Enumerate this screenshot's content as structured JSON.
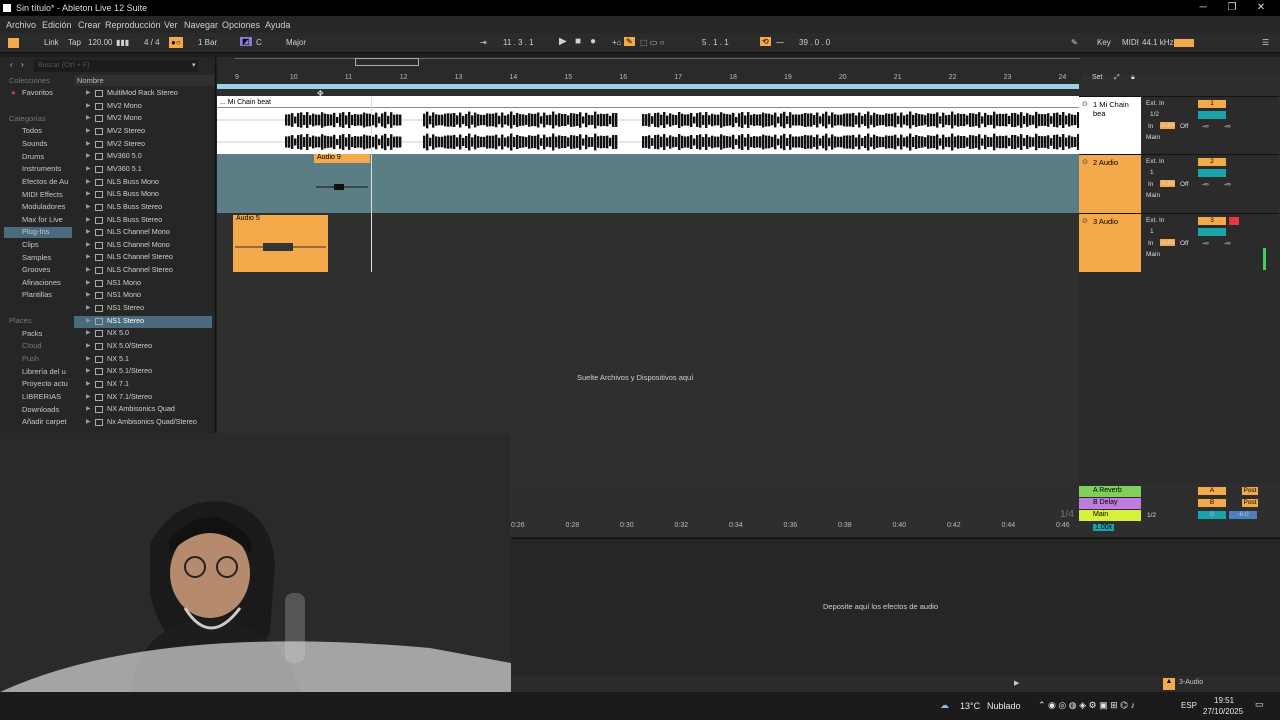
{
  "window": {
    "title": "Sin título* - Ableton Live 12 Suite"
  },
  "menu": [
    "Archivo",
    "Edición",
    "Crear",
    "Reproducción",
    "Ver",
    "Navegar",
    "Opciones",
    "Ayuda"
  ],
  "controlbar": {
    "link": "Link",
    "tap": "Tap",
    "tempo": "120.00",
    "signature": "4 / 4",
    "quantize": "1 Bar",
    "key": "C",
    "scale": "Major",
    "position": "11 .  3 .  1",
    "punch": "5 .  1 .  1",
    "loop_len": "39 .  0 .  0",
    "key_label": "Key",
    "midi_label": "MIDI",
    "sample_rate": "44.1 kHz"
  },
  "browser": {
    "search_placeholder": "Buscar (Ctrl + F)",
    "colecciones_header": "Colecciones",
    "favoritos": "Favoritos",
    "categorias_header": "Categorías",
    "categories": [
      "Todos",
      "Sounds",
      "Drums",
      "Instruments",
      "Efectos de Au",
      "MIDI Effects",
      "Moduladores",
      "Max for Live",
      "Plug-Ins",
      "Clips",
      "Samples",
      "Grooves",
      "Afinaciones",
      "Plantillas"
    ],
    "selected_category": "Plug-Ins",
    "places_header": "Places",
    "places": [
      "Packs",
      "Cloud",
      "Push",
      "Librería del u",
      "Proyecto actu",
      "LIBRERIAS",
      "Downloads",
      "Añadir carpet"
    ],
    "column_header": "Nombre",
    "items": [
      "MultiMod Rack Stereo",
      "MV2 Mono",
      "MV2 Mono",
      "MV2 Stereo",
      "MV2 Stereo",
      "MV360 5.0",
      "MV360 5.1",
      "NLS Buss Mono",
      "NLS Buss Mono",
      "NLS Buss Stereo",
      "NLS Buss Stereo",
      "NLS Channel Mono",
      "NLS Channel Mono",
      "NLS Channel Stereo",
      "NLS Channel Stereo",
      "NS1 Mono",
      "NS1 Mono",
      "NS1 Stereo",
      "NS1 Stereo",
      "NX 5.0",
      "NX 5.0/Stereo",
      "NX 5.1",
      "NX 5.1/Stereo",
      "NX 7.1",
      "NX 7.1/Stereo",
      "NX Ambisonics Quad",
      "Nx Ambisonics Quad/Stereo"
    ],
    "selected_item": "NS1 Stereo"
  },
  "arrangement": {
    "ruler": [
      "9",
      "10",
      "11",
      "12",
      "13",
      "14",
      "15",
      "16",
      "17",
      "18",
      "19",
      "20",
      "21",
      "22",
      "23",
      "24"
    ],
    "set_label": "Set",
    "clips": {
      "t1": "Mi Chain beat",
      "t2": "Audio 9",
      "t3": "Audio 5"
    },
    "drop_hint": "Suelte Archivos y Dispositivos aquí",
    "tracks": [
      {
        "name": "1 Mi Chain bea",
        "input": "Ext. In",
        "channel": "1/2",
        "out": "Main",
        "num": "1",
        "color": "#ffffff"
      },
      {
        "name": "2 Audio",
        "input": "Ext. In",
        "channel": "1",
        "out": "Main",
        "num": "2",
        "color": "#f4a94a"
      },
      {
        "name": "3 Audio",
        "input": "Ext. In",
        "channel": "1",
        "out": "Main",
        "num": "3",
        "color": "#f4a94a"
      }
    ],
    "monitor": {
      "in": "In",
      "auto": "Auto",
      "off": "Off",
      "inf": "-∞"
    },
    "returns": [
      {
        "name": "A Reverb",
        "letter": "A",
        "post": "Post",
        "color": "#7ed05a"
      },
      {
        "name": "B Delay",
        "letter": "B",
        "post": "Post",
        "color": "#c07be0"
      },
      {
        "name": "Main",
        "channel": "1/2",
        "vol": "0",
        "pan": "-6.0",
        "color": "#d6f03c"
      }
    ],
    "zoom": "1/4",
    "speed": "1.00x",
    "times": [
      "0:26",
      "0:28",
      "0:30",
      "0:32",
      "0:34",
      "0:36",
      "0:38",
      "0:40",
      "0:42",
      "0:44",
      "0:46"
    ]
  },
  "device_view": {
    "hint": "Deposite aquí los efectos de audio",
    "track_label": "3-Audio"
  },
  "taskbar": {
    "temp": "13°C",
    "weather": "Nublado",
    "lang": "ESP",
    "time": "19:51",
    "date": "27/10/2025"
  }
}
